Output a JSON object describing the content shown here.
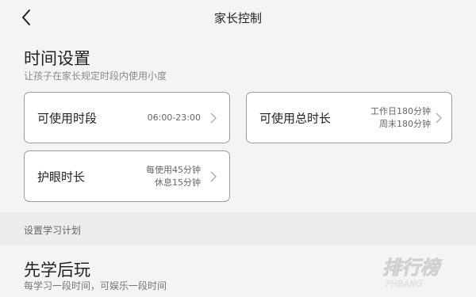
{
  "header": {
    "title": "家长控制",
    "back_icon": "chevron-left-icon"
  },
  "time_settings": {
    "title": "时间设置",
    "subtitle": "让孩子在家长规定时段内使用小度",
    "cards": {
      "period": {
        "label": "可使用时段",
        "value_line1": "06:00-23:00"
      },
      "total": {
        "label": "可使用总时长",
        "value_line1": "工作日180分钟",
        "value_line2": "周末180分钟"
      },
      "eye": {
        "label": "护眼时长",
        "value_line1": "每使用45分钟",
        "value_line2": "休息15分钟"
      }
    }
  },
  "study_plan": {
    "section_label": "设置学习计划",
    "title": "先学后玩",
    "subtitle": "每学习一段时间，可娱乐一段时间"
  },
  "watermark": {
    "text": "排行榜",
    "subtext": "PHBANG"
  },
  "colors": {
    "background": "#f4f4f4",
    "card": "#ffffff",
    "card_border": "#9a9a9a",
    "band": "#ececec"
  }
}
